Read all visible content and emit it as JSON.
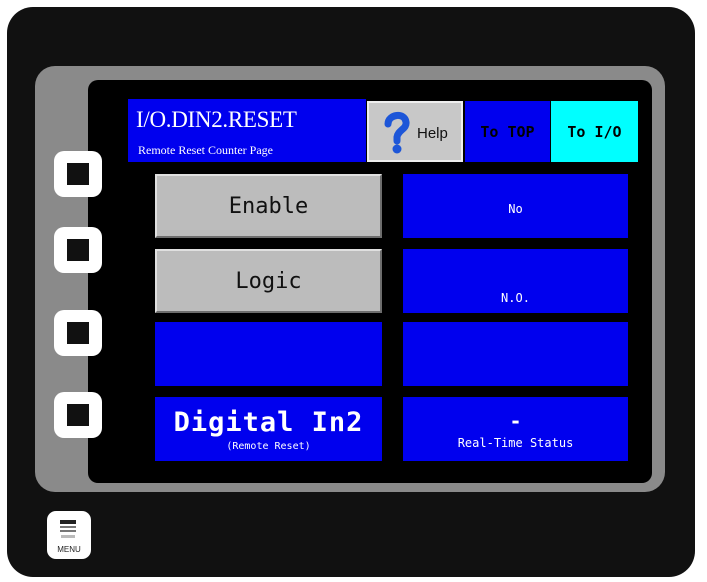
{
  "header": {
    "page_code": "I/O.DIN2.RESET",
    "subtitle": "Remote Reset Counter Page",
    "help_label": "Help",
    "to_top_label": "To TOP",
    "to_io_label": "To I/O"
  },
  "settings": {
    "enable_label": "Enable",
    "enable_value": "No",
    "logic_label": "Logic",
    "logic_value": "N.O."
  },
  "input": {
    "title": "Digital In2",
    "subtitle": "(Remote Reset)",
    "status_value": "-",
    "status_label": "Real-Time Status"
  },
  "device": {
    "menu_label": "MENU"
  },
  "colors": {
    "screen_blue": "#0000ee",
    "cyan": "#00ffff",
    "button_grey": "#bcbcbc",
    "bezel_grey": "#8a8a8a"
  },
  "icons": {
    "help": "question-mark-icon",
    "menu": "menu-icon",
    "side_keys": "square-key-icon"
  }
}
